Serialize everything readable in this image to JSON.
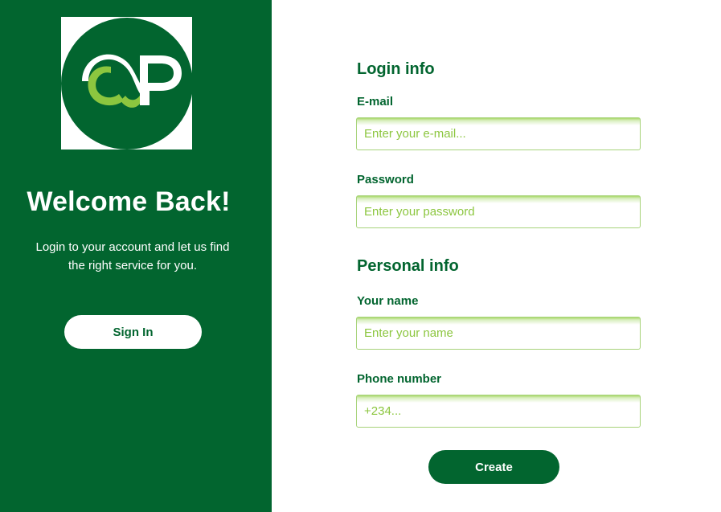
{
  "welcome": {
    "title": "Welcome Back!",
    "subtitle": "Login to your account and let us find the right service for you.",
    "signin_label": "Sign In"
  },
  "logo": {
    "icon": "cp-logo-icon"
  },
  "login_section": {
    "title": "Login info",
    "email_label": "E-mail",
    "email_placeholder": "Enter your e-mail...",
    "password_label": "Password",
    "password_placeholder": "Enter your password"
  },
  "personal_section": {
    "title": "Personal info",
    "name_label": "Your name",
    "name_placeholder": "Enter your name",
    "phone_label": "Phone number",
    "phone_placeholder": "+234..."
  },
  "actions": {
    "create_label": "Create"
  },
  "colors": {
    "brand_dark": "#02652f",
    "brand_light": "#8cc63f",
    "white": "#ffffff"
  }
}
